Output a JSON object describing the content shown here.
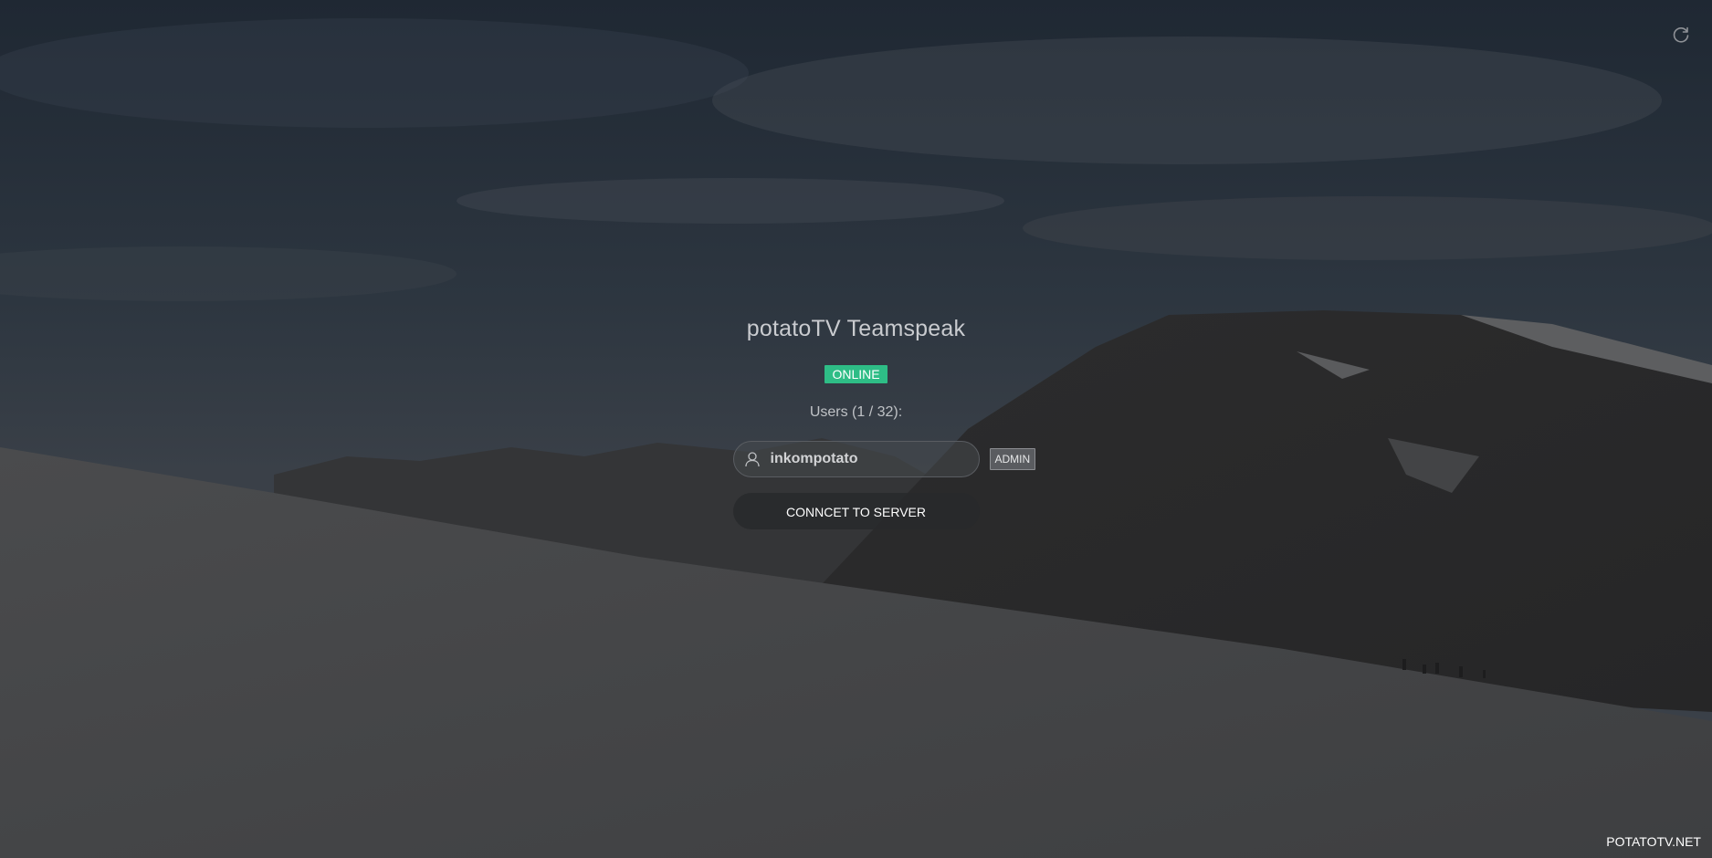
{
  "server": {
    "title": "potatoTV Teamspeak",
    "status": "ONLINE",
    "status_color": "#2ebd86",
    "users_heading": "Users (1 / 32):"
  },
  "users": [
    {
      "name": "inkompotato",
      "icon": "user-icon",
      "role": "ADMIN"
    }
  ],
  "actions": {
    "connect_label": "CONNCET TO SERVER",
    "refresh_icon": "refresh-icon"
  },
  "footer": {
    "brand": "POTATOTV.NET"
  },
  "colors": {
    "overlay": "#2b2f35",
    "badge": "#2ebd86"
  }
}
